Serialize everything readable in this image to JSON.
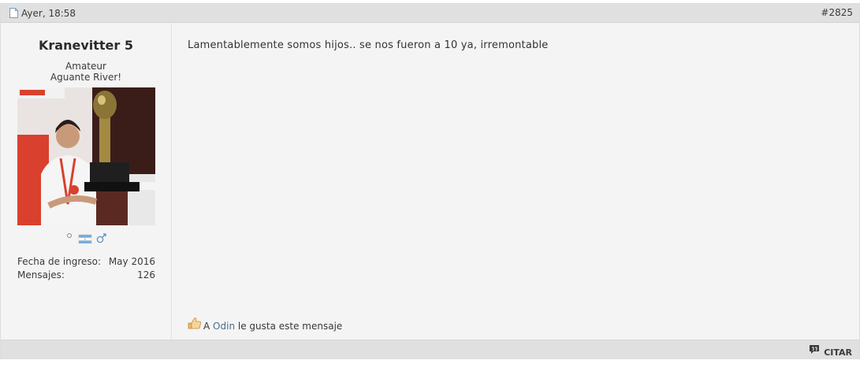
{
  "post": {
    "date": "Ayer, 18:58",
    "number": "#2825"
  },
  "user": {
    "name": "Kranevitter 5",
    "rank": "Amateur",
    "custom_title": "Aguante River!",
    "avatar_icon": "avatar-photo-trophy",
    "status_icons": [
      "offline-status-icon",
      "argentina-flag-icon",
      "male-gender-icon"
    ],
    "details": [
      {
        "label": "Fecha de ingreso:",
        "value": "May 2016"
      },
      {
        "label": "Mensajes:",
        "value": "126"
      }
    ]
  },
  "message": {
    "text": "Lamentablemente somos hijos.. se nos fueron a 10 ya, irremontable"
  },
  "likes": {
    "prefix": "A",
    "user": "Odin",
    "suffix": "le gusta este mensaje"
  },
  "footer": {
    "quote_label": "CITAR"
  },
  "colors": {
    "header_bg": "#e0e0e0",
    "body_bg": "#f4f4f4",
    "link": "#4a6d92"
  }
}
